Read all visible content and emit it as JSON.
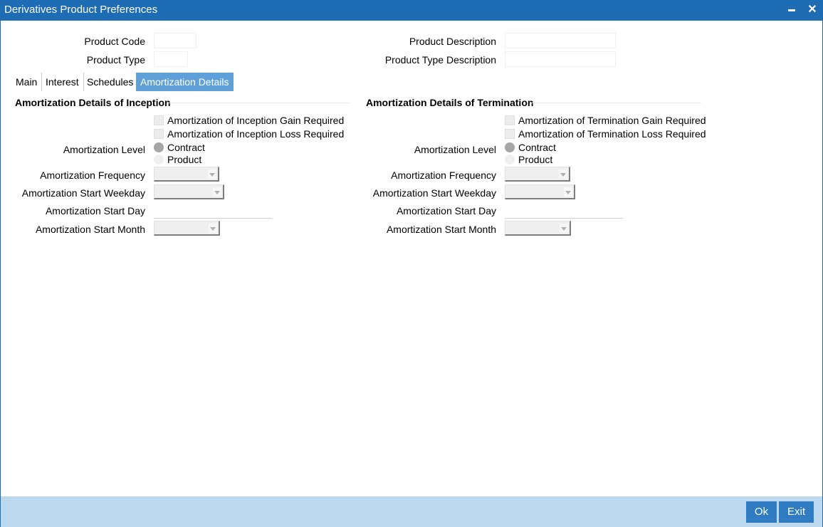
{
  "window": {
    "title": "Derivatives Product Preferences",
    "minimize_icon": "minimize-icon",
    "close_icon": "close-icon",
    "close_glyph": "✕"
  },
  "header": {
    "product_code_label": "Product Code",
    "product_code_value": "",
    "product_type_label": "Product Type",
    "product_type_value": "",
    "product_description_label": "Product Description",
    "product_description_value": "",
    "product_type_description_label": "Product Type Description",
    "product_type_description_value": ""
  },
  "tabs": [
    {
      "label": "Main",
      "active": false
    },
    {
      "label": "Interest",
      "active": false
    },
    {
      "label": "Schedules",
      "active": false
    },
    {
      "label": "Amortization Details",
      "active": true
    }
  ],
  "inception": {
    "title": "Amortization Details of Inception",
    "gain_label": "Amortization of Inception Gain Required",
    "gain_checked": false,
    "loss_label": "Amortization of Inception Loss Required",
    "loss_checked": false,
    "level_label": "Amortization Level",
    "level_options": [
      "Contract",
      "Product"
    ],
    "level_selected": "Contract",
    "frequency_label": "Amortization Frequency",
    "frequency_value": "",
    "start_weekday_label": "Amortization Start Weekday",
    "start_weekday_value": "",
    "start_day_label": "Amortization Start Day",
    "start_day_value": "",
    "start_month_label": "Amortization Start Month",
    "start_month_value": ""
  },
  "termination": {
    "title": "Amortization Details of Termination",
    "gain_label": "Amortization of Termination Gain Required",
    "gain_checked": false,
    "loss_label": "Amortization of Termination Loss Required",
    "loss_checked": false,
    "level_label": "Amortization Level",
    "level_options": [
      "Contract",
      "Product"
    ],
    "level_selected": "Contract",
    "frequency_label": "Amortization Frequency",
    "frequency_value": "",
    "start_weekday_label": "Amortization Start Weekday",
    "start_weekday_value": "",
    "start_day_label": "Amortization Start Day",
    "start_day_value": "",
    "start_month_label": "Amortization Start Month",
    "start_month_value": ""
  },
  "footer": {
    "ok_label": "Ok",
    "exit_label": "Exit"
  },
  "colors": {
    "titlebar": "#1e6cb4",
    "active_tab": "#5fa0d8",
    "footer": "#bcd8ef",
    "button": "#2f7cc2"
  }
}
